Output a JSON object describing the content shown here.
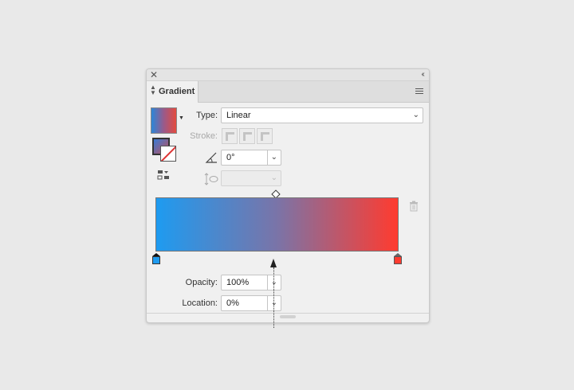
{
  "panel": {
    "tab_label": "Gradient",
    "close_icon": "close-icon",
    "collapse_icon": "double-chevron-left-icon",
    "menu_icon": "panel-menu-icon"
  },
  "controls": {
    "type_label": "Type:",
    "type_value": "Linear",
    "stroke_label": "Stroke:",
    "angle_value": "0°",
    "aspect_value": ""
  },
  "gradient": {
    "start_color": "#1e9bf0",
    "mid_color": "#7a74a8",
    "end_color": "#ff3b2f",
    "midpoint_location": 50,
    "stops": [
      {
        "color": "#1e9bf0",
        "location": 0,
        "selected": true
      },
      {
        "color": "#ff3b2f",
        "location": 100,
        "selected": false
      }
    ]
  },
  "stop_options": {
    "opacity_label": "Opacity:",
    "opacity_value": "100%",
    "location_label": "Location:",
    "location_value": "0%"
  },
  "colors": {
    "panel_bg": "#f0f0f0",
    "page_bg": "#e9e9e9"
  }
}
